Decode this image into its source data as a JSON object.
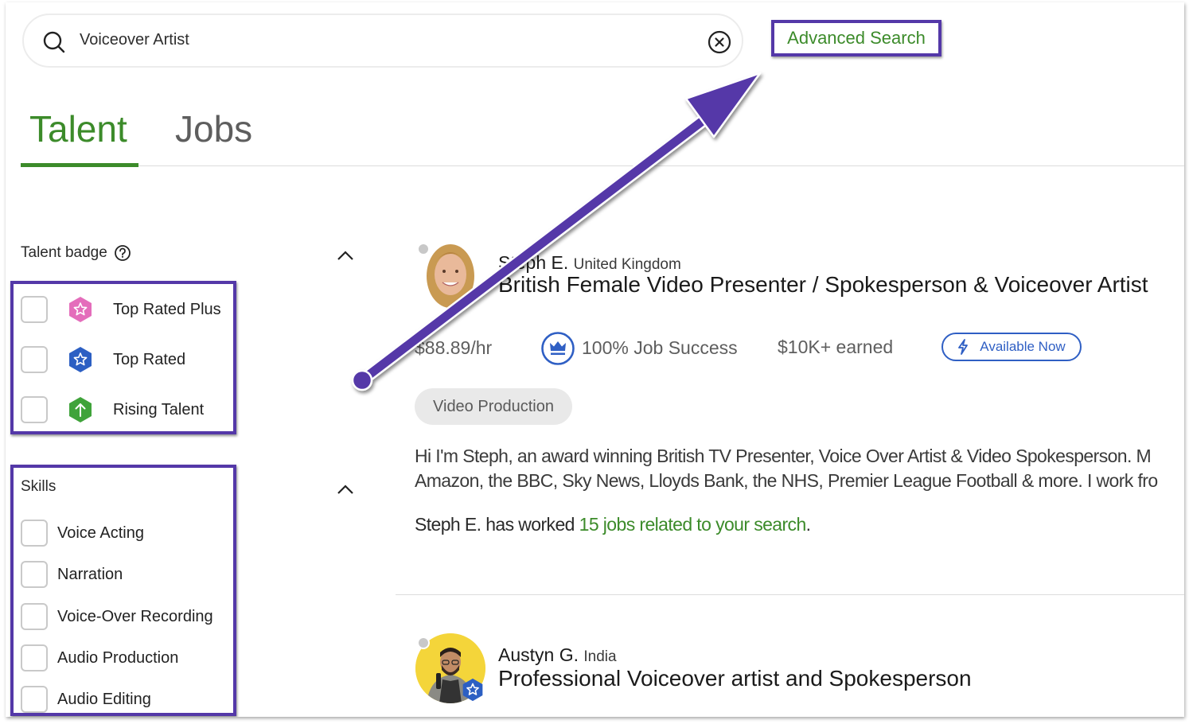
{
  "search": {
    "value": "Voiceover Artist",
    "icon": "search-icon",
    "clear_icon": "clear-circle-x-icon"
  },
  "advanced_search": {
    "label": "Advanced Search"
  },
  "tabs": [
    {
      "label": "Talent",
      "active": true
    },
    {
      "label": "Jobs",
      "active": false
    }
  ],
  "filters": {
    "talent_badge": {
      "title": "Talent badge",
      "help_icon": "question-circle-icon",
      "options": [
        {
          "label": "Top Rated Plus",
          "icon": "top-rated-plus-badge-icon",
          "color": "#e46dbb",
          "checked": false
        },
        {
          "label": "Top Rated",
          "icon": "top-rated-badge-icon",
          "color": "#2c5fc3",
          "checked": false
        },
        {
          "label": "Rising Talent",
          "icon": "rising-talent-badge-icon",
          "color": "#3fa33a",
          "checked": false
        }
      ]
    },
    "skills": {
      "title": "Skills",
      "options": [
        {
          "label": "Voice Acting",
          "checked": false
        },
        {
          "label": "Narration",
          "checked": false
        },
        {
          "label": "Voice-Over Recording",
          "checked": false
        },
        {
          "label": "Audio Production",
          "checked": false
        },
        {
          "label": "Audio Editing",
          "checked": false
        }
      ]
    }
  },
  "results": [
    {
      "name": "Steph E.",
      "location": "United Kingdom",
      "title": "British Female Video Presenter / Spokesperson & Voiceover Artist",
      "rate": "$88.89/hr",
      "job_success": "100% Job Success",
      "earned": "$10K+ earned",
      "availability": "Available Now",
      "skills": [
        "Video Production"
      ],
      "description_lines": [
        "Hi I'm Steph, an award winning British TV Presenter, Voice Over Artist & Video Spokesperson. M",
        "Amazon, the BBC, Sky News, Lloyds Bank, the NHS, Premier League Football & more. I work fro"
      ],
      "worked_prefix": "Steph E. has worked ",
      "worked_link": "15 jobs related to your search",
      "worked_suffix": "."
    },
    {
      "name": "Austyn G.",
      "location": "India",
      "title": "Professional Voiceover artist and Spokesperson",
      "badge": "top-rated-badge-icon"
    }
  ],
  "annotation": {
    "color": "#5438a8",
    "description": "Arrow pointing to Advanced Search; highlight boxes around Talent badge options and Skills filter"
  },
  "colors": {
    "brand_green": "#3c8b2a",
    "annotation_purple": "#5438a8",
    "link_blue": "#2f5fc4"
  }
}
